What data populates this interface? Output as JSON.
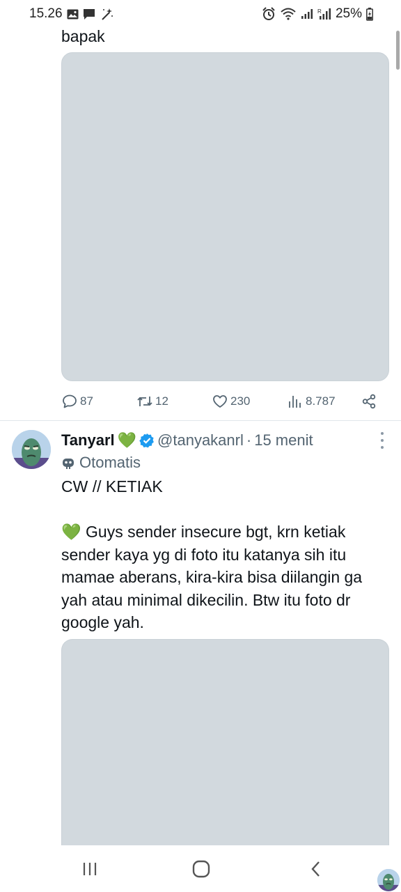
{
  "status_bar": {
    "time": "15.26",
    "battery": "25%",
    "left_icons": [
      "gallery-icon",
      "message-icon",
      "magic-wand-icon"
    ],
    "right_icons": [
      "alarm-icon",
      "wifi-icon",
      "signal-icon",
      "signal-roaming-icon",
      "battery-charging-icon"
    ]
  },
  "tweet1": {
    "text_end": "bapak",
    "actions": {
      "replies": "87",
      "retweets": "12",
      "likes": "230",
      "views": "8.787"
    }
  },
  "tweet2": {
    "author_name": "Tanyarl",
    "name_emoji": "💚",
    "handle": "@tanyakanrl",
    "separator": "·",
    "time": "15 menit",
    "automated_label": "Otomatis",
    "title": "CW // KETIAK",
    "body_emoji": "💚",
    "body": "Guys sender insecure bgt, krn ketiak sender kaya yg di foto itu katanya sih itu mamae aberans, kira-kira bisa diilangin ga yah atau minimal dikecilin. Btw itu foto dr google yah."
  },
  "colors": {
    "text": "#0f1419",
    "secondary": "#536471",
    "verified": "#1d9bf0",
    "media_placeholder": "#d2d9de",
    "divider": "#e1e6ea"
  },
  "nav_bar": {
    "icons": [
      "recent-apps-icon",
      "home-icon",
      "back-icon"
    ]
  }
}
